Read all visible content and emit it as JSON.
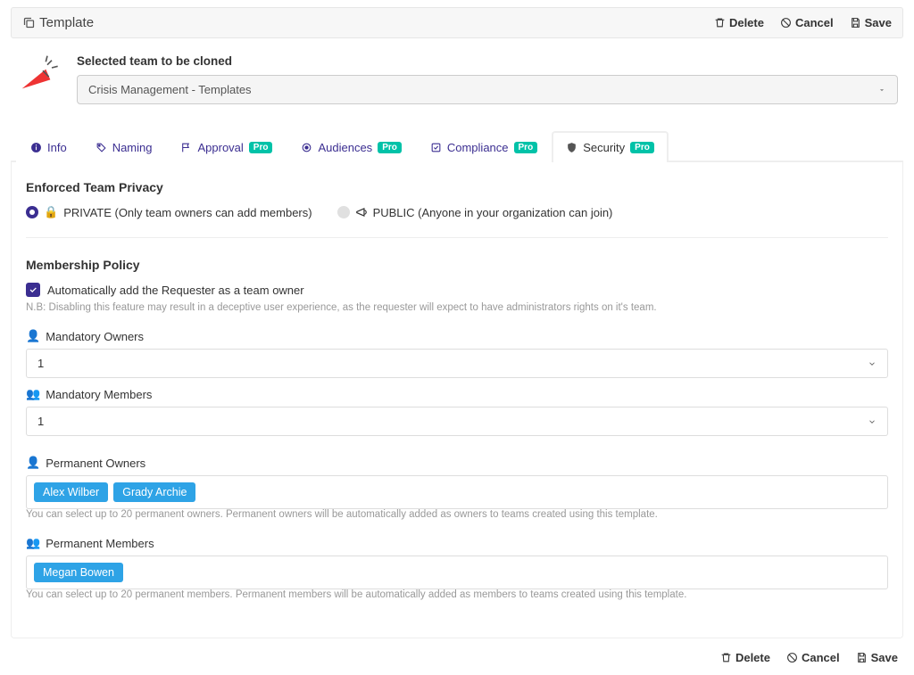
{
  "header": {
    "title": "Template",
    "actions": {
      "delete": "Delete",
      "cancel": "Cancel",
      "save": "Save"
    }
  },
  "clone": {
    "label": "Selected team to be cloned",
    "selected": "Crisis Management - Templates"
  },
  "tabs": {
    "info": "Info",
    "naming": "Naming",
    "approval": "Approval",
    "audiences": "Audiences",
    "compliance": "Compliance",
    "security": "Security",
    "pro": "Pro"
  },
  "privacy": {
    "title": "Enforced Team Privacy",
    "private": "PRIVATE (Only team owners can add members)",
    "public": "PUBLIC (Anyone in your organization can join)"
  },
  "membership": {
    "title": "Membership Policy",
    "auto_requester": "Automatically add the Requester as a team owner",
    "auto_requester_hint": "N.B: Disabling this feature may result in a deceptive user experience, as the requester will expect to have administrators rights on it's team.",
    "mandatory_owners_label": "Mandatory Owners",
    "mandatory_owners_value": "1",
    "mandatory_members_label": "Mandatory Members",
    "mandatory_members_value": "1",
    "permanent_owners_label": "Permanent Owners",
    "permanent_owners": [
      "Alex Wilber",
      "Grady Archie"
    ],
    "permanent_owners_hint": "You can select up to 20 permanent owners. Permanent owners will be automatically added as owners to teams created using this template.",
    "permanent_members_label": "Permanent Members",
    "permanent_members": [
      "Megan Bowen"
    ],
    "permanent_members_hint": "You can select up to 20 permanent members. Permanent members will be automatically added as members to teams created using this template."
  },
  "footer": {
    "delete": "Delete",
    "cancel": "Cancel",
    "save": "Save"
  }
}
